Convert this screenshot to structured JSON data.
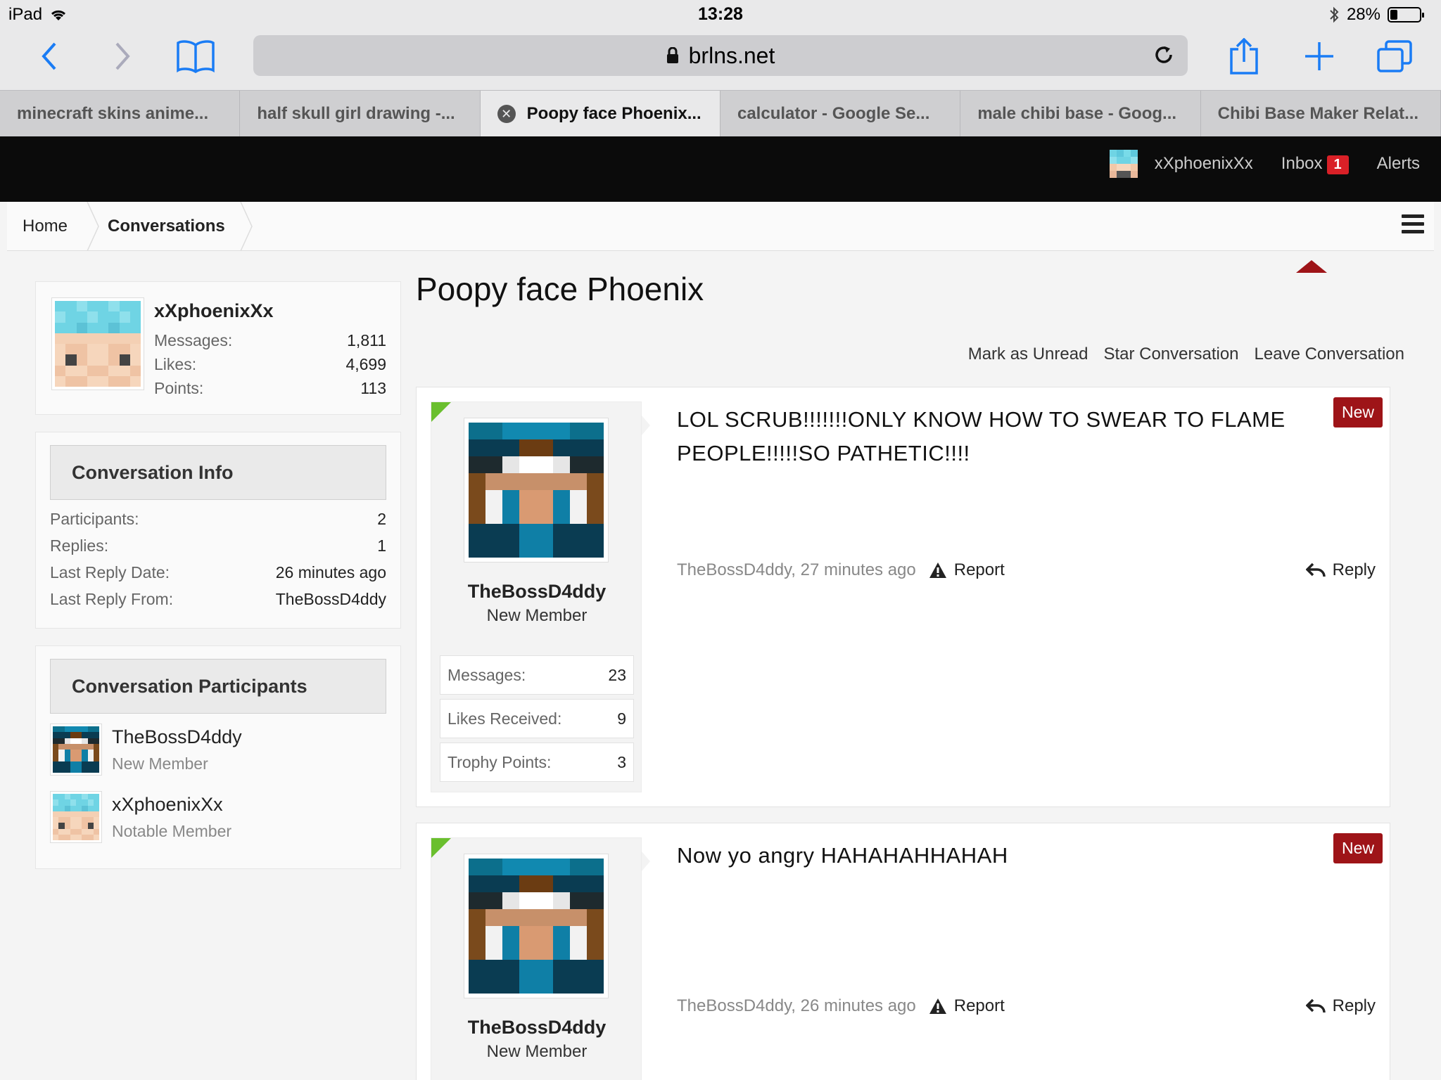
{
  "status_bar": {
    "device": "iPad",
    "time": "13:28",
    "battery": "28%"
  },
  "browser": {
    "url": "brlns.net",
    "tabs": [
      {
        "label": "minecraft skins anime..."
      },
      {
        "label": "half skull girl drawing -..."
      },
      {
        "label": "Poopy face Phoenix..."
      },
      {
        "label": "calculator - Google Se..."
      },
      {
        "label": "male chibi base - Goog..."
      },
      {
        "label": "Chibi Base Maker Relat..."
      }
    ]
  },
  "site_header": {
    "username": "xXphoenixXx",
    "inbox_label": "Inbox",
    "inbox_count": "1",
    "alerts_label": "Alerts"
  },
  "breadcrumb": {
    "home": "Home",
    "current": "Conversations"
  },
  "profile": {
    "username": "xXphoenixXx",
    "stats": [
      {
        "label": "Messages:",
        "value": "1,811"
      },
      {
        "label": "Likes:",
        "value": "4,699"
      },
      {
        "label": "Points:",
        "value": "113"
      }
    ]
  },
  "conversation_info": {
    "heading": "Conversation Info",
    "rows": [
      {
        "label": "Participants:",
        "value": "2"
      },
      {
        "label": "Replies:",
        "value": "1"
      },
      {
        "label": "Last Reply Date:",
        "value": "26 minutes ago"
      },
      {
        "label": "Last Reply From:",
        "value": "TheBossD4ddy"
      }
    ]
  },
  "participants": {
    "heading": "Conversation Participants",
    "items": [
      {
        "name": "TheBossD4ddy",
        "role": "New Member"
      },
      {
        "name": "xXphoenixXx",
        "role": "Notable Member"
      }
    ]
  },
  "conversation": {
    "title": "Poopy face Phoenix",
    "actions": [
      "Mark as Unread",
      "Star Conversation",
      "Leave Conversation"
    ],
    "messages": [
      {
        "author": "TheBossD4ddy",
        "role": "New Member",
        "stats": [
          {
            "label": "Messages:",
            "value": "23"
          },
          {
            "label": "Likes Received:",
            "value": "9"
          },
          {
            "label": "Trophy Points:",
            "value": "3"
          }
        ],
        "text": "LOL SCRUB!!!!!!!ONLY KNOW HOW TO SWEAR TO FLAME PEOPLE!!!!!SO PATHETIC!!!!",
        "tag": "New",
        "meta": "TheBossD4ddy, 27 minutes ago",
        "report_label": "Report",
        "reply_label": "Reply"
      },
      {
        "author": "TheBossD4ddy",
        "role": "New Member",
        "text": "Now yo angry HAHAHAHHAHAH",
        "tag": "New",
        "meta": "TheBossD4ddy, 26 minutes ago",
        "report_label": "Report",
        "reply_label": "Reply"
      }
    ]
  },
  "colors": {
    "accent_red": "#9e1418",
    "badge_red": "#d92027",
    "new_corner_green": "#6abf2e",
    "header_black": "#0b0b0b"
  }
}
